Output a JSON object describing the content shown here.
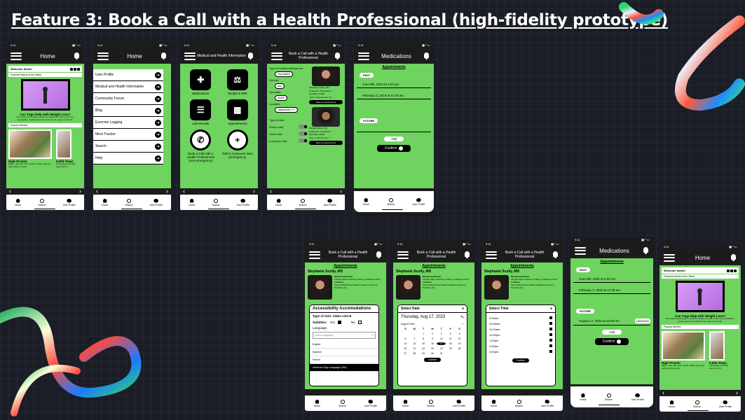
{
  "board": {
    "title": "Feature 3: Book a Call with a Health Professional (high-fidelity prototype)"
  },
  "colors": {
    "screen_green": "#6fd35f",
    "frame": "#1c1c1c",
    "board_bg": "#1a1d26"
  },
  "status_time": "9:41",
  "tabbar": {
    "home": "Home",
    "search": "Search",
    "profile": "User Profile"
  },
  "home": {
    "title": "Home",
    "welcome": "Welcome Sarah!",
    "featured": "Featured Article of the Week",
    "video_title": "Can Yoga Help with Weight Loss?",
    "video_sub": "One study found yoga is useful for weight loss due to the non-competitive, social support provided by the yoga community.",
    "popular": "Popular Articles",
    "article1_title": "High Protein",
    "article1_sub": "Eight + diet with more protein. Might help your performance needs.",
    "article2_title": "9,000 Steps",
    "article2_sub": "Increasing your daily step count is"
  },
  "menu": {
    "title": "Home",
    "items": [
      "User Profile",
      "Medical and Health Information",
      "Community Forum",
      "Blog",
      "Exercise Logging",
      "Meal Tracker",
      "Search",
      "Help"
    ]
  },
  "medical": {
    "title": "Medical and Health Information",
    "items": [
      "Medications",
      "Weight & BMI",
      "Lab Results",
      "Appointments",
      "Book a Call with a Health Professional (non-emergency)",
      "Talk to Someone Now (emergency)"
    ]
  },
  "book": {
    "title": "Book a Call with a Health Professional",
    "type_label": "Type of health professional:",
    "type_value": "Psychiatrist",
    "gender_label": "Gender:",
    "gender_value": "Any",
    "specialty_label": "Specialty:",
    "specialty_value": "ADHD",
    "location_label": "Location:",
    "location_value": "Tallahassee, FL",
    "visit_label": "Type of visit:",
    "phone": "Phone visit:",
    "video": "Video visit:",
    "inperson": "In-person visit:",
    "doc1_name": "Stephanie Scully, MD",
    "doc1_prof": "Profession: Psychiatrist",
    "doc1_spec": "Specialty: ADHD",
    "doc1_years": "Years of Experience: 10",
    "doc2_name": "Michael Moore, MD",
    "doc2_prof": "Profession: Psychiatrist",
    "doc2_spec": "Specialty: ADHD",
    "doc2_years": "Years of Experience: 7",
    "book_btn": "Book an Appointment"
  },
  "meds1": {
    "title": "Medications",
    "appointments": "Appointments",
    "past": "PAST",
    "past1": "June 8th, 2023 at 4:00 pm",
    "past2": "February 2, 2023 at 11:30 am",
    "future": "FUTURE",
    "add": "Add",
    "confirm": "Confirm"
  },
  "profile": {
    "title": "Book a Call with a Health Professional",
    "appointments": "Appointments",
    "name": "Stephanie Scully, MD",
    "edu_label": "Medical Education",
    "edu": "Florida State University College of Medicine 2013",
    "loc_label": "Location",
    "loc": "Sacred Behavioral Health Outpatient Center at Montford, FA"
  },
  "access": {
    "heading": "Accessibility Accomodations",
    "visit_type": "Type of visit: Video visit",
    "subtitles": "Subtitles:",
    "yes": "Yes",
    "no": "No",
    "language": "Language:",
    "select_lang": "Select Language",
    "langs": [
      "English",
      "Spanish",
      "French",
      "American Sign Language (ASL)"
    ]
  },
  "date": {
    "heading": "Select Date",
    "selected": "Thursday, Aug 17, 2023",
    "month": "August 2023",
    "days": [
      "S",
      "M",
      "T",
      "W",
      "T",
      "F",
      "S"
    ],
    "nums": [
      "",
      "",
      "1",
      "2",
      "3",
      "4",
      "5",
      "6",
      "7",
      "8",
      "9",
      "10",
      "11",
      "12",
      "13",
      "14",
      "15",
      "16",
      "17",
      "18",
      "19",
      "20",
      "21",
      "22",
      "23",
      "24",
      "25",
      "26",
      "27",
      "28",
      "29",
      "30",
      "31",
      "",
      ""
    ],
    "confirm": "Confirm"
  },
  "time": {
    "heading": "Select Time",
    "slots": [
      "9:00am",
      "10:00am",
      "11:00am",
      "12:00pm",
      "1:00pm",
      "2:00pm",
      "3:00pm"
    ],
    "confirm": "Confirm"
  },
  "meds2": {
    "title": "Medications",
    "appointments": "Appointments",
    "past": "PAST",
    "past1": "June 8th, 2022 at 4:00 pm",
    "past2": "February 2, 2022 at 11:30 am",
    "future": "FUTURE",
    "future1": "August 17, 2023 at 10:00 am",
    "edit": "edit/delete",
    "add": "Add",
    "confirm": "Confirm"
  }
}
